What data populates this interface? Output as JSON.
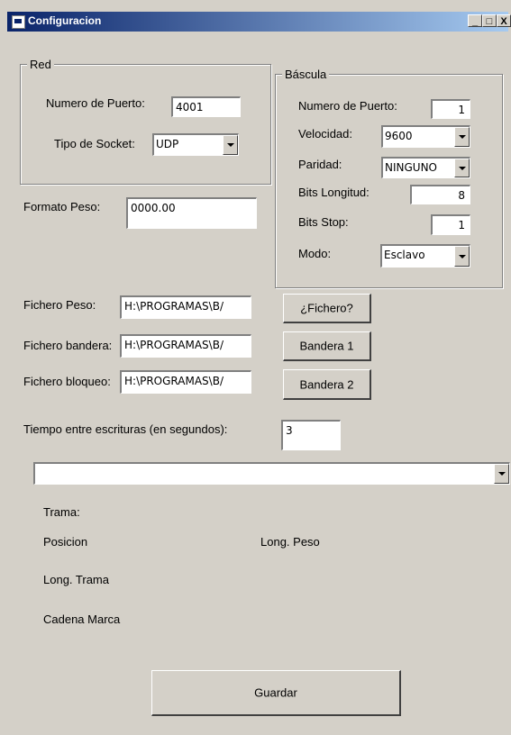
{
  "window": {
    "title": "Configuracion",
    "buttons": {
      "minimize": "_",
      "maximize": "□",
      "close": "X"
    }
  },
  "red": {
    "frame_title": "Red",
    "puerto_label": "Numero de Puerto:",
    "puerto_value": "4001",
    "socket_label": "Tipo de Socket:",
    "socket_value": "UDP"
  },
  "formato": {
    "label": "Formato Peso:",
    "value": "0000.00"
  },
  "bascula": {
    "frame_title": "Báscula",
    "puerto_label": "Numero de Puerto:",
    "puerto_value": "1",
    "velocidad_label": "Velocidad:",
    "velocidad_value": "9600",
    "paridad_label": "Paridad:",
    "paridad_value": "NINGUNO",
    "bits_longitud_label": "Bits Longitud:",
    "bits_longitud_value": "8",
    "bits_stop_label": "Bits Stop:",
    "bits_stop_value": "1",
    "modo_label": "Modo:",
    "modo_value": "Esclavo"
  },
  "ficheros": {
    "peso_label": "Fichero Peso:",
    "peso_value": "H:\\PROGRAMAS\\B/",
    "peso_button": "¿Fichero?",
    "bandera_label": "Fichero bandera:",
    "bandera_value": "H:\\PROGRAMAS\\B/",
    "bandera_button": "Bandera 1",
    "bloqueo_label": "Fichero bloqueo:",
    "bloqueo_value": "H:\\PROGRAMAS\\B/",
    "bloqueo_button": "Bandera 2"
  },
  "tiempo": {
    "label": "Tiempo entre escrituras (en segundos):",
    "value": "3"
  },
  "trama": {
    "dropdown_value": "",
    "trama_label": "Trama:",
    "posicion_label": "Posicion",
    "long_peso_label": "Long. Peso",
    "long_trama_label": "Long. Trama",
    "cadena_marca_label": "Cadena Marca"
  },
  "actions": {
    "guardar": "Guardar"
  }
}
